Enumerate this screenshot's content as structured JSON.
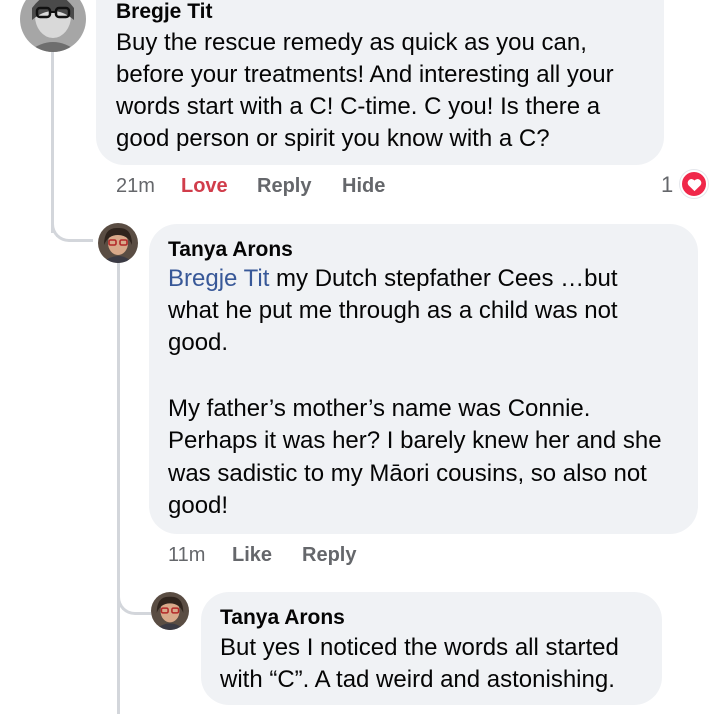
{
  "comment1": {
    "author": "Bregje Tit",
    "lines": [
      "Buy the rescue remedy as quick as you can,",
      "before your treatments! And interesting all your",
      "words start with a C! C-time. C you! Is there a",
      "good person or spirit you know with a C?"
    ],
    "timestamp": "21m",
    "love_label": "Love",
    "reply_label": "Reply",
    "hide_label": "Hide",
    "reaction_count": "1",
    "reaction_icon": "heart-icon",
    "reaction_color": "#f0284a"
  },
  "reply1": {
    "author": "Tanya Arons",
    "mention": "Bregje Tit",
    "line1_rest": " my Dutch stepfather Cees …but",
    "lines_a": [
      "what he put me through as a child was not",
      "good."
    ],
    "lines_b": [
      "My father’s mother’s name was Connie.",
      "Perhaps it was her? I barely knew her and she",
      "was sadistic to my Māori cousins, so also not",
      "good!"
    ],
    "timestamp": "11m",
    "like_label": "Like",
    "reply_label": "Reply"
  },
  "reply2": {
    "author": "Tanya Arons",
    "lines": [
      "But yes I noticed the words all started",
      "with “C”.  A tad weird and astonishing."
    ]
  },
  "colors": {
    "bubble": "#f0f2f5",
    "mention": "#385898",
    "love_active": "#d13d4b",
    "meta_text": "#65676b"
  }
}
